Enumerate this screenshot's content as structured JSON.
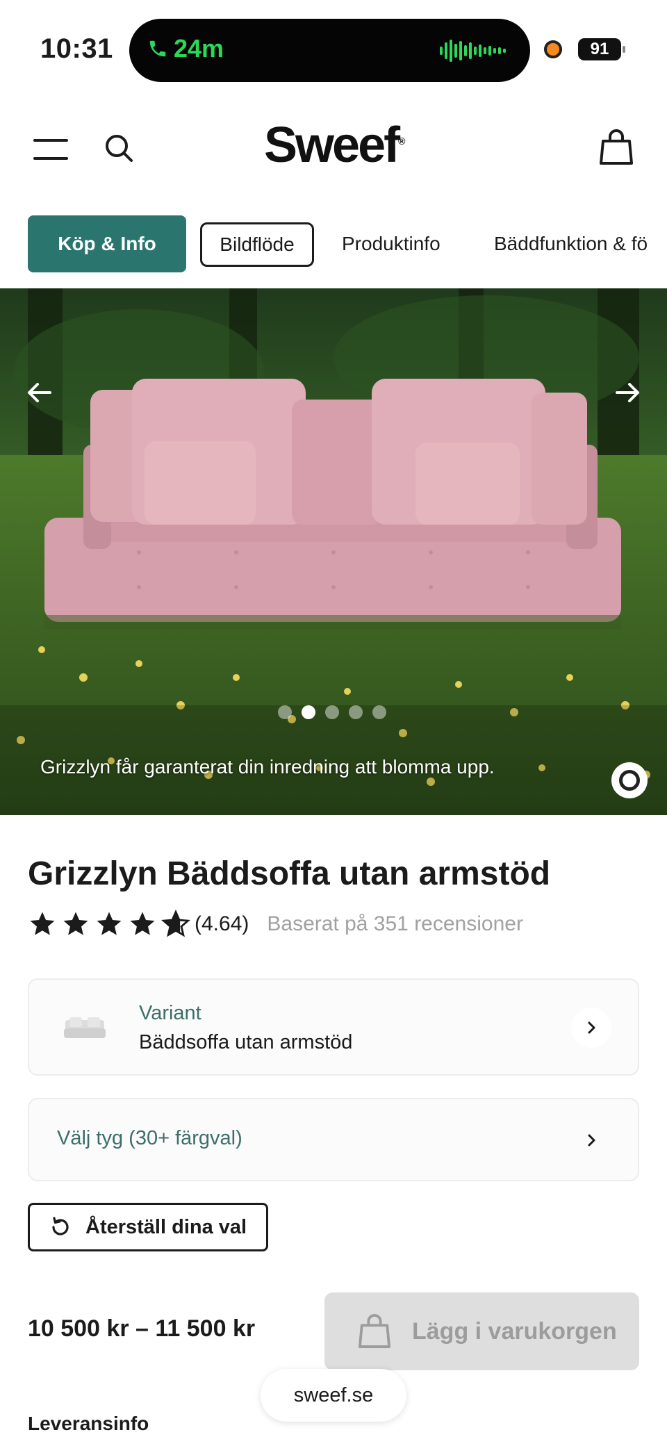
{
  "status_bar": {
    "time": "10:31",
    "call_duration": "24m",
    "battery": "91"
  },
  "header": {
    "logo": "Sweef",
    "logo_mark": "®"
  },
  "tabs": [
    {
      "label": "Köp & Info"
    },
    {
      "label": "Bildflöde"
    },
    {
      "label": "Produktinfo"
    },
    {
      "label": "Bäddfunktion & fö"
    }
  ],
  "hero": {
    "caption": "Grizzlyn får garanterat din inredning att blomma upp.",
    "slide_count": 5,
    "active_slide": 2
  },
  "product": {
    "title": "Grizzlyn Bäddsoffa utan armstöd",
    "rating_value": 4.64,
    "rating_display": "(4.64)",
    "reviews_text": "Baserat på 351 recensioner"
  },
  "variant": {
    "label": "Variant",
    "value": "Bäddsoffa utan armstöd"
  },
  "fabric": {
    "label": "Välj tyg (30+ färgval)"
  },
  "reset": {
    "label": "Återställ dina val"
  },
  "purchase": {
    "price": "10 500 kr – 11 500 kr",
    "cart_label": "Lägg i varukorgen"
  },
  "browser": {
    "url": "sweef.se"
  },
  "delivery": {
    "label": "Leveransinfo"
  },
  "colors": {
    "accent": "#2b756f",
    "disabled": "#dedede",
    "call_green": "#2bd95a",
    "sofa_pink": "#d9a3ae"
  }
}
